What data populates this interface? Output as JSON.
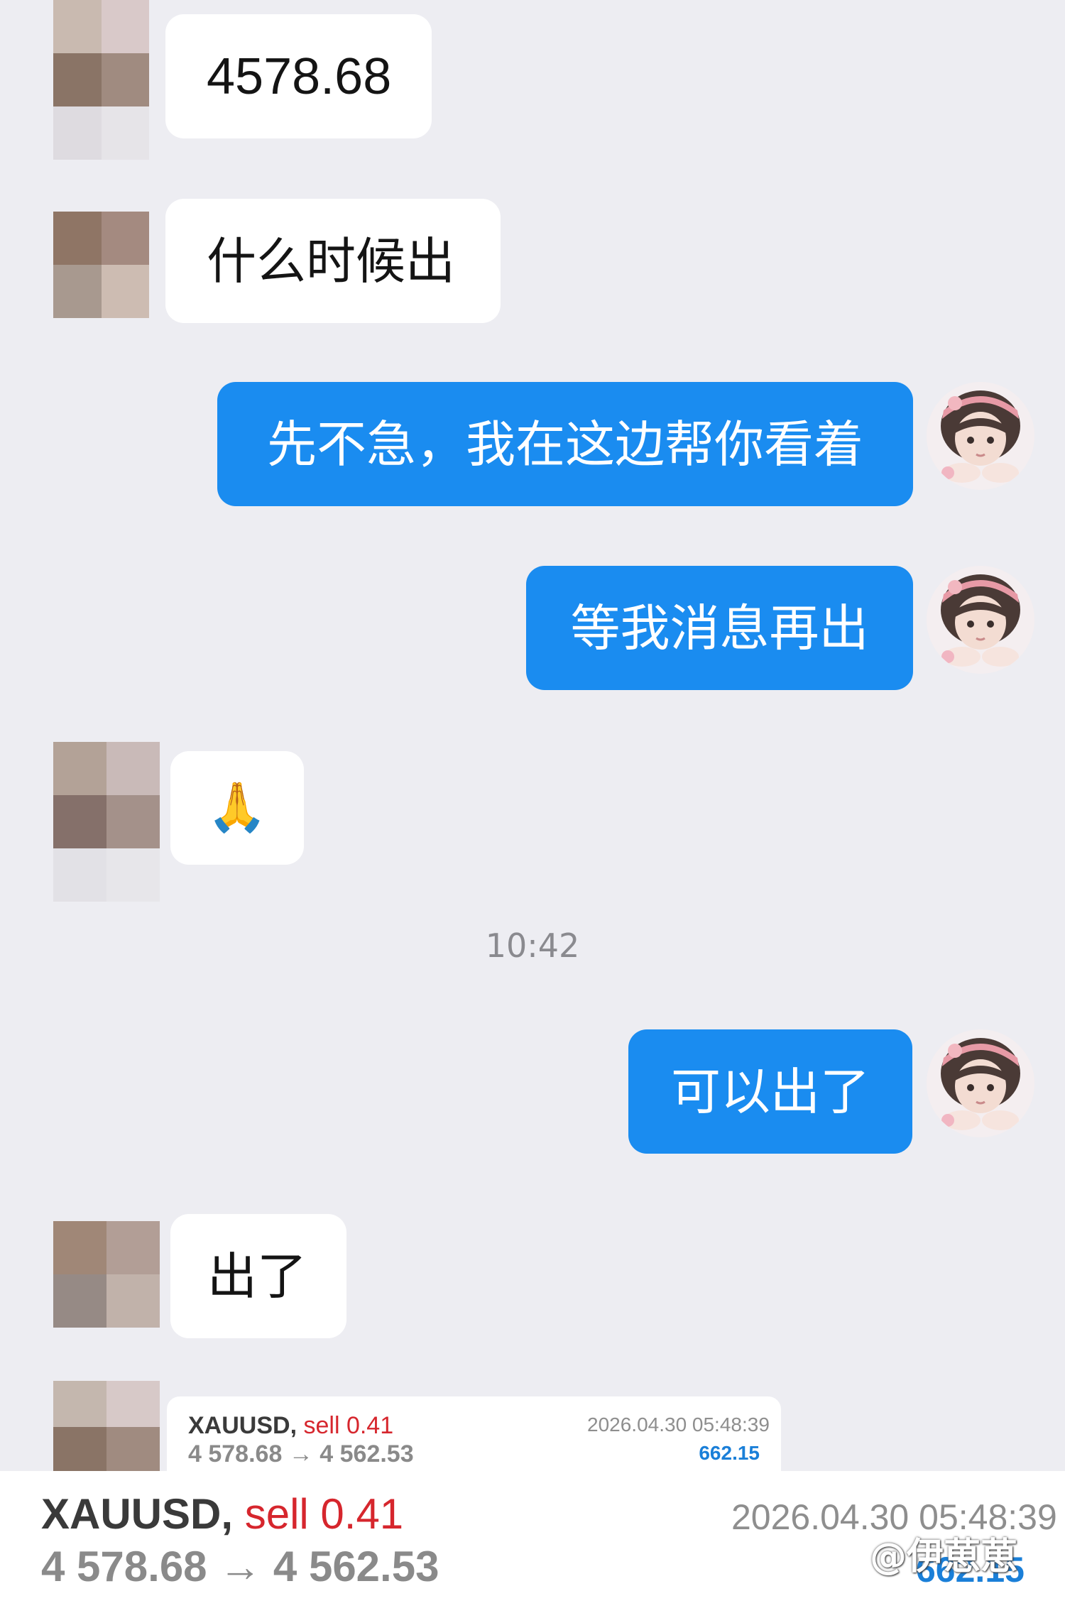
{
  "messages": [
    {
      "from": "other",
      "text": "4578.68"
    },
    {
      "from": "other",
      "text": "什么时候出"
    },
    {
      "from": "self",
      "text": "先不急，我在这边帮你看着"
    },
    {
      "from": "self",
      "text": "等我消息再出"
    },
    {
      "from": "other",
      "text": "🙏"
    },
    {
      "from": "self",
      "text": "可以出了"
    },
    {
      "from": "other",
      "text": "出了"
    }
  ],
  "timestamp": "10:42",
  "trade_card_small": {
    "symbol": "XAUUSD,",
    "action": "sell 0.41",
    "price_from": "4 578.68",
    "arrow": "→",
    "price_to": "4 562.53",
    "datetime": "2026.04.30 05:48:39",
    "profit": "662.15"
  },
  "trade_card_large": {
    "symbol": "XAUUSD,",
    "action": "sell 0.41",
    "price_from": "4 578.68",
    "arrow": "→",
    "price_to": "4 562.53",
    "datetime": "2026.04.30 05:48:39",
    "profit": "662.15"
  },
  "watermark": "@伊葸葸",
  "colors": {
    "background": "#ededf2",
    "outgoing_bubble": "#1a8cf0",
    "incoming_bubble": "#ffffff",
    "sell": "#d6262d",
    "profit": "#1a7fd8"
  }
}
